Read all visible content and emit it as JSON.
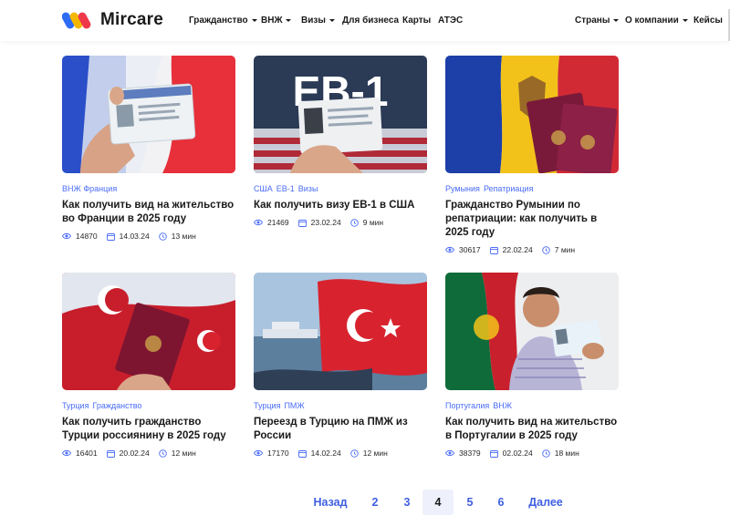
{
  "header": {
    "logo_text": "Mircare",
    "nav_left": [
      {
        "label": "Гражданство",
        "dropdown": true
      },
      {
        "label": "ВНЖ",
        "dropdown": true
      },
      {
        "label": "Визы",
        "dropdown": true
      },
      {
        "label": "Для бизнеса",
        "dropdown": false
      },
      {
        "label": "Карты",
        "dropdown": false
      },
      {
        "label": "АТЭС",
        "dropdown": false
      }
    ],
    "nav_right": [
      {
        "label": "Страны",
        "dropdown": true
      },
      {
        "label": "О компании",
        "dropdown": true
      },
      {
        "label": "Кейсы",
        "dropdown": false
      }
    ]
  },
  "cards": [
    {
      "tags": [
        "ВНЖ Франция"
      ],
      "title": "Как получить вид на жительство во Франции в 2025 году",
      "views": "14870",
      "date": "14.03.24",
      "read_time": "13 мин",
      "image": "france-residence-card"
    },
    {
      "tags": [
        "США",
        "EB-1",
        "Визы"
      ],
      "title": "Как получить визу EB-1 в США",
      "views": "21469",
      "date": "23.02.24",
      "read_time": "9 мин",
      "image": "eb1-card-usa-flag"
    },
    {
      "tags": [
        "Румыния",
        "Репатриация"
      ],
      "title": "Гражданство Румынии по репатриации: как получить в 2025 году",
      "views": "30617",
      "date": "22.02.24",
      "read_time": "7 мин",
      "image": "moldova-flag-romanian-passports"
    },
    {
      "tags": [
        "Турция",
        "Гражданство"
      ],
      "title": "Как получить гражданство Турции россиянину в 2025 году",
      "views": "16401",
      "date": "20.02.24",
      "read_time": "12 мин",
      "image": "turkish-passport-flags"
    },
    {
      "tags": [
        "Турция",
        "ПМЖ"
      ],
      "title": "Переезд в Турцию на ПМЖ из России",
      "views": "17170",
      "date": "14.02.24",
      "read_time": "12 мин",
      "image": "turkish-flag-ship"
    },
    {
      "tags": [
        "Португалия",
        "ВНЖ"
      ],
      "title": "Как получить вид на жительство в Португалии в 2025 году",
      "views": "38379",
      "date": "02.02.24",
      "read_time": "18 мин",
      "image": "portugal-man-card"
    }
  ],
  "pagination": {
    "prev": "Назад",
    "pages": [
      "2",
      "3",
      "4",
      "5",
      "6"
    ],
    "current": "4",
    "next": "Далее"
  },
  "colors": {
    "accent": "#4a6cf7",
    "text": "#1a1a1a",
    "active_page_bg": "#eef1fb"
  }
}
